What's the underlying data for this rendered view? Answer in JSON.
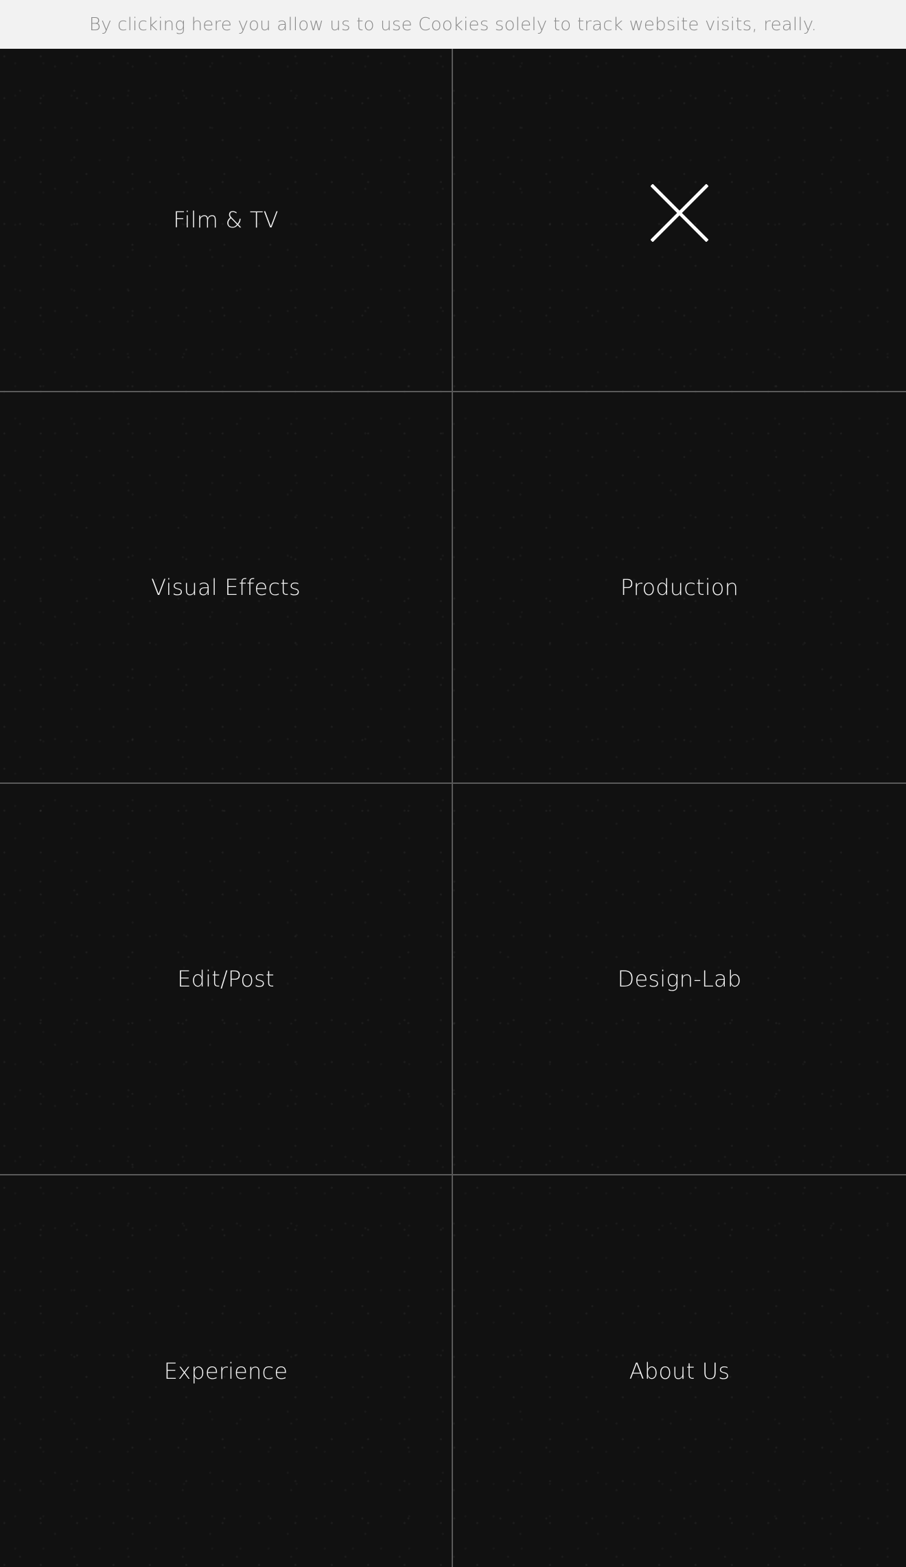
{
  "cookie_notice": {
    "text": "By clicking here you allow us to use Cookies solely to track website visits, really."
  },
  "menu": {
    "items": [
      {
        "label": "Film & TV"
      },
      {
        "label": "Visual Effects"
      },
      {
        "label": "Production"
      },
      {
        "label": "Edit/Post"
      },
      {
        "label": "Design-Lab"
      },
      {
        "label": "Experience"
      },
      {
        "label": "About Us"
      }
    ],
    "close_icon": "close-icon"
  },
  "colors": {
    "background": "#111111",
    "text": "#f3f3f3",
    "divider": "#5a5a5a",
    "cookie_background": "#f2f2f2",
    "cookie_text": "#8a8a8a"
  }
}
